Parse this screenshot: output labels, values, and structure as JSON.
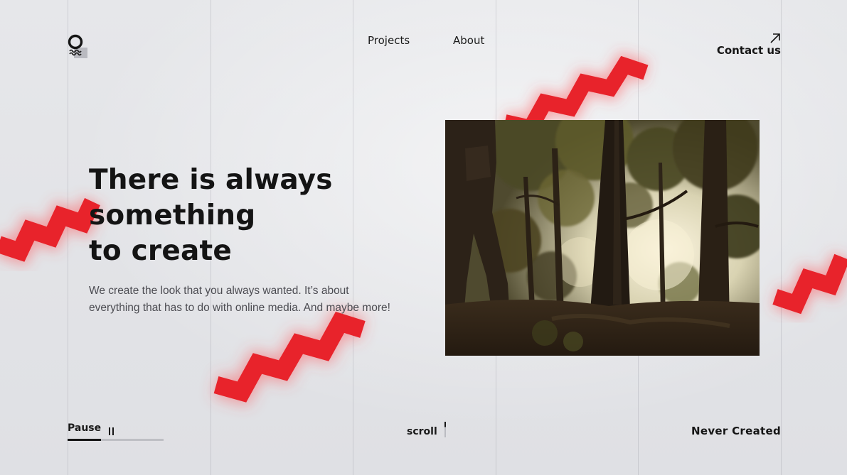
{
  "nav": {
    "projects_label": "Projects",
    "about_label": "About",
    "contact_label": "Contact us"
  },
  "hero": {
    "headline_lines": [
      "There is always",
      "something",
      "to create"
    ],
    "lede_lines": [
      "We create the look that you always wanted. It’s about",
      "everything that has to do with online media. And maybe more!"
    ]
  },
  "video": {
    "state_label": "Pause",
    "progress_fraction": 0.35
  },
  "scroll_label": "scroll",
  "brand_word": "Never Created",
  "icons": {
    "logo": "ring-wave-logo",
    "contact": "arrow-up-right-icon",
    "pause": "pause-icon"
  },
  "colors": {
    "accent": "#e8232b",
    "background": "#e4e5e8",
    "text": "#151515"
  }
}
